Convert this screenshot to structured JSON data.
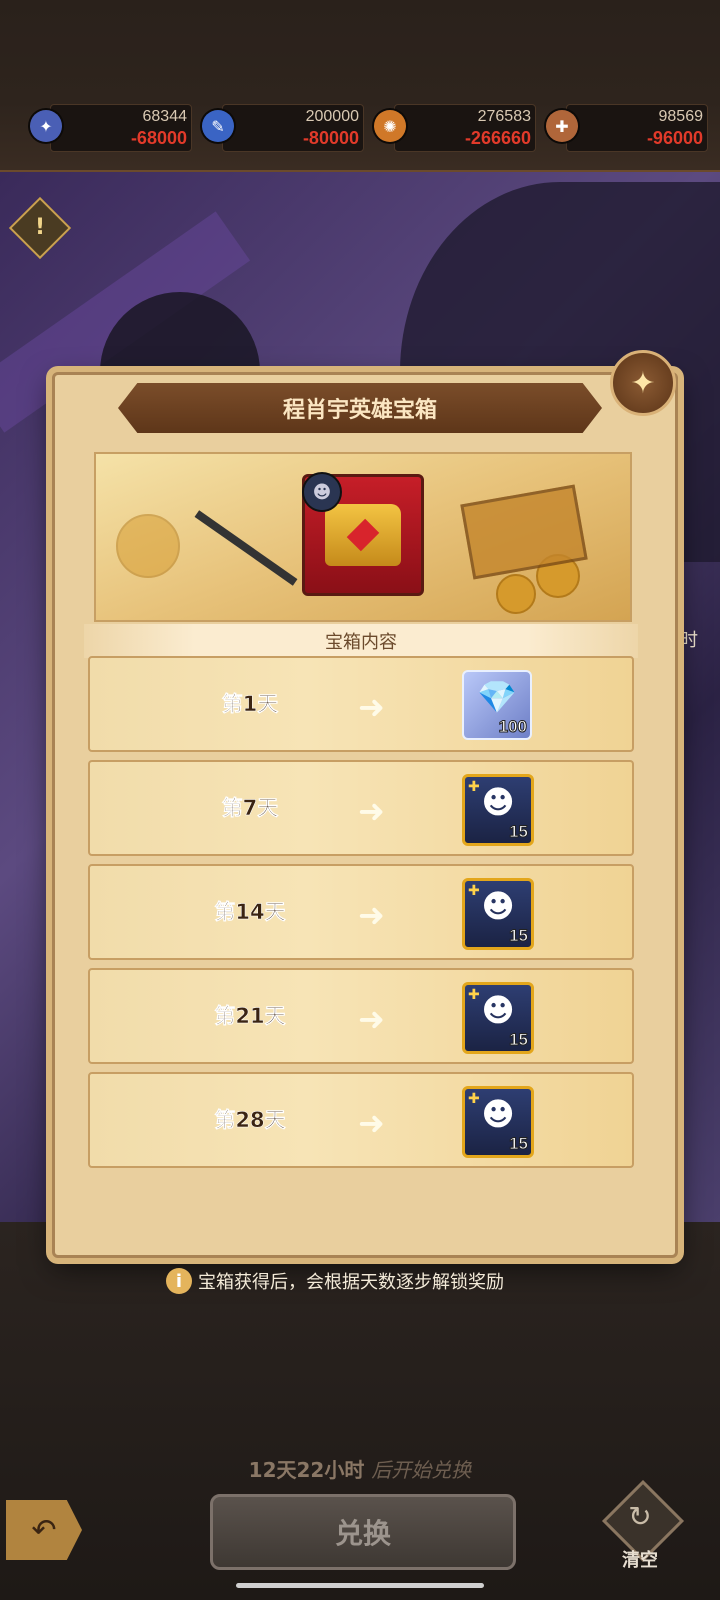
{
  "resources": [
    {
      "icon": "blue-medal-icon",
      "value": "68344",
      "cost": "-68000",
      "color": "#4a5fb5"
    },
    {
      "icon": "blue-quill-icon",
      "value": "200000",
      "cost": "-80000",
      "color": "#3a64c4"
    },
    {
      "icon": "orange-coin-icon",
      "value": "276583",
      "cost": "-266660",
      "color": "#d07828"
    },
    {
      "icon": "bronze-medal-icon",
      "value": "98569",
      "cost": "-96000",
      "color": "#b0663a"
    }
  ],
  "modal": {
    "title": "程肖宇英雄宝箱",
    "subtitle": "宝箱内容",
    "rewards": [
      {
        "day": "第1天",
        "item": "diamond-icon",
        "count": "100"
      },
      {
        "day": "第7天",
        "item": "hero-fragment-icon",
        "count": "15"
      },
      {
        "day": "第14天",
        "item": "hero-fragment-icon",
        "count": "15"
      },
      {
        "day": "第21天",
        "item": "hero-fragment-icon",
        "count": "15"
      },
      {
        "day": "第28天",
        "item": "hero-fragment-icon",
        "count": "15"
      }
    ]
  },
  "tip": "宝箱获得后，会根据天数逐步解锁奖励",
  "side_text": "小时",
  "countdown": {
    "time": "12天22小时",
    "suffix": "后开始兑换"
  },
  "buttons": {
    "exchange": "兑换",
    "clear": "清空"
  }
}
